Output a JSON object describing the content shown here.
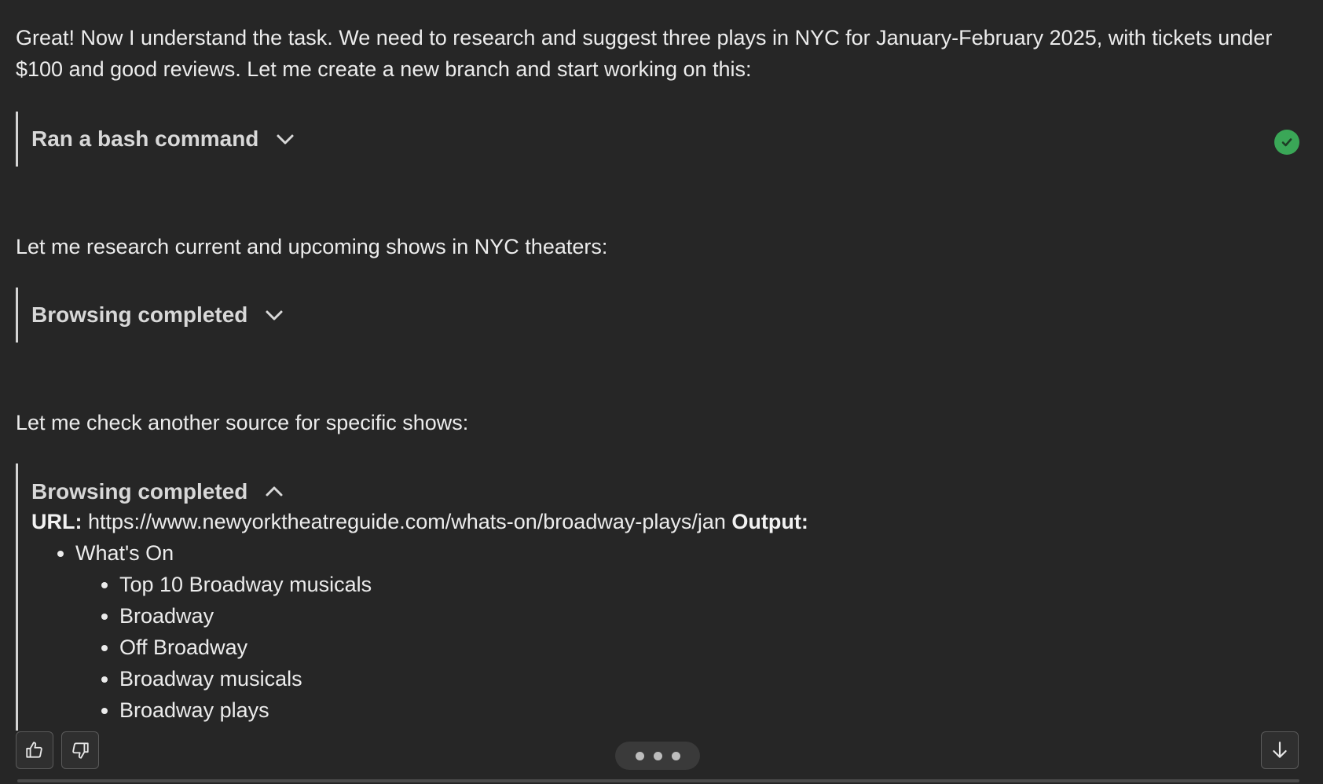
{
  "messages": {
    "intro": "Great! Now I understand the task. We need to research and suggest three plays in NYC for January-February 2025, with tickets under $100 and good reviews. Let me create a new branch and start working on this:",
    "research": "Let me research current and upcoming shows in NYC theaters:",
    "check": "Let me check another source for specific shows:"
  },
  "blocks": {
    "bash": {
      "title": "Ran a bash command",
      "status_icon": "check-circle-icon"
    },
    "browse1": {
      "title": "Browsing completed"
    },
    "browse2": {
      "title": "Browsing completed",
      "url_label": "URL:",
      "url": "https://www.newyorktheatreguide.com/whats-on/broadway-plays/jan",
      "output_label": "Output:",
      "list_top": "What's On",
      "list_items": [
        "Top 10 Broadway musicals",
        "Broadway",
        "Off Broadway",
        "Broadway musicals",
        "Broadway plays"
      ]
    }
  },
  "footer": {
    "thumbs_up_icon": "thumbs-up-icon",
    "thumbs_down_icon": "thumbs-down-icon",
    "more_icon": "ellipsis-icon",
    "scroll_icon": "arrow-down-icon"
  },
  "colors": {
    "background": "#262626",
    "success": "#3aa757",
    "text": "#ececec"
  }
}
